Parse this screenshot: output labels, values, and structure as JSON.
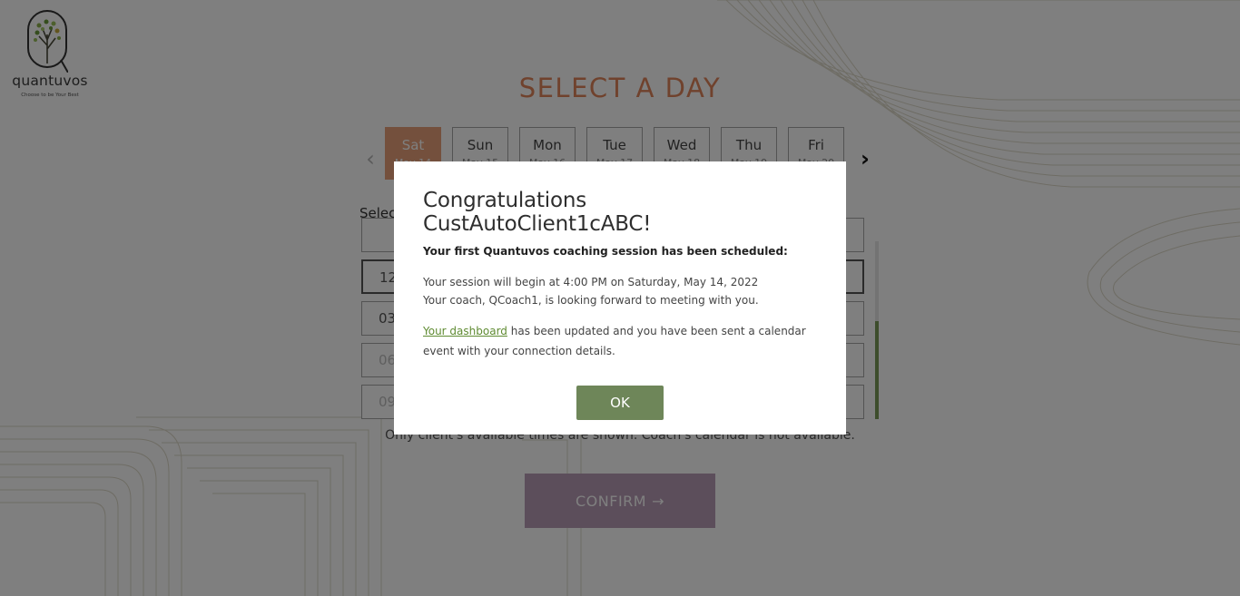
{
  "brand": {
    "name": "quantuvos",
    "tagline": "Choose to be Your Best"
  },
  "heading": "SELECT A DAY",
  "days": [
    {
      "name": "Sat",
      "date": "May 14",
      "active": true
    },
    {
      "name": "Sun",
      "date": "May 15",
      "active": false
    },
    {
      "name": "Mon",
      "date": "May 16",
      "active": false
    },
    {
      "name": "Tue",
      "date": "May 17",
      "active": false
    },
    {
      "name": "Wed",
      "date": "May 18",
      "active": false
    },
    {
      "name": "Thu",
      "date": "May 19",
      "active": false
    },
    {
      "name": "Fri",
      "date": "May 20",
      "active": false
    }
  ],
  "select_time_label": "Selec",
  "time_slots": [
    {
      "label": "",
      "style": "partial"
    },
    {
      "label": "12",
      "style": "bold"
    },
    {
      "label": "03",
      "style": "normal"
    },
    {
      "label": "06",
      "style": "faded"
    },
    {
      "label": "09",
      "style": "faded"
    }
  ],
  "availability_note": "Only client's available times are shown. Coach's calendar is not available.",
  "confirm_label": "CONFIRM",
  "modal": {
    "title": "Congratulations CustAutoClient1cABC!",
    "subtitle": "Your first Quantuvos coaching session has been scheduled:",
    "line1": "Your session will begin at 4:00 PM on Saturday, May 14, 2022",
    "line2": "Your coach, QCoach1, is looking forward to meeting with you.",
    "link_text": "Your dashboard",
    "link_rest": " has been updated and you have been sent a calendar event with your connection details.",
    "ok_label": "OK"
  },
  "colors": {
    "accent_orange": "#e0855a",
    "brand_green": "#6e8659",
    "confirm_purple": "#b89db7",
    "link_green": "#5f8b32"
  }
}
